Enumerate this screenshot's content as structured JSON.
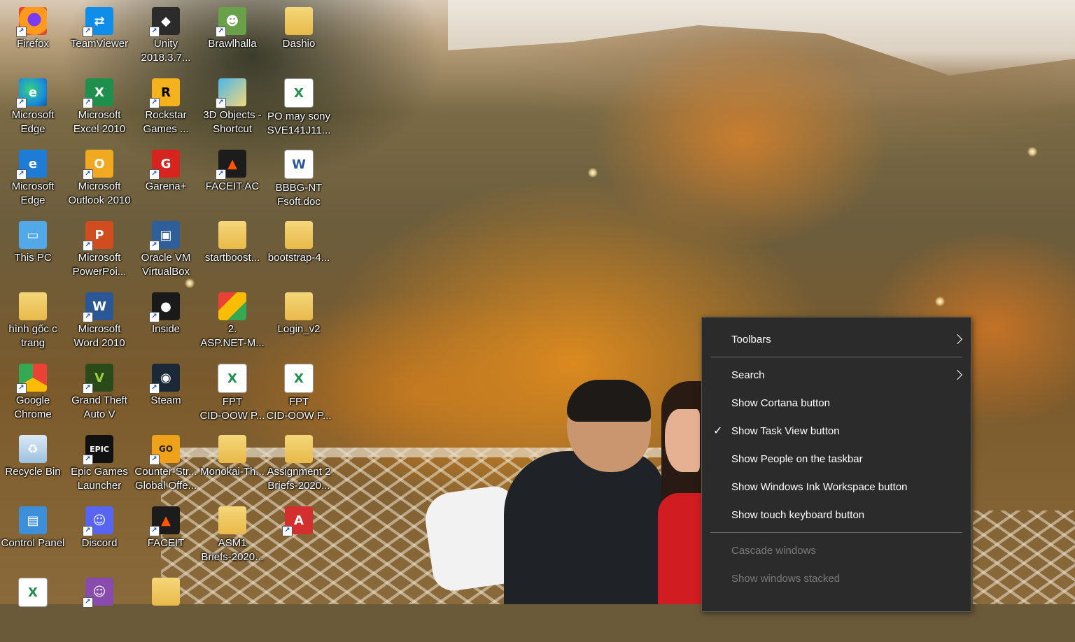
{
  "desktop": {
    "icons": [
      {
        "label": "Firefox",
        "icon": "firefox-icon",
        "glyph": ""
      },
      {
        "label": "TeamViewer",
        "icon": "teamviewer-icon",
        "glyph": "⇄"
      },
      {
        "label": "Unity\n2018.3.7...",
        "icon": "unity-icon",
        "glyph": "◆"
      },
      {
        "label": "Brawlhalla",
        "icon": "brawlhalla-icon",
        "glyph": "☻"
      },
      {
        "label": "Dashio",
        "icon": "folder-icon",
        "glyph": ""
      },
      {
        "label": "Microsoft\nEdge",
        "icon": "edge-icon",
        "glyph": "e"
      },
      {
        "label": "Microsoft\nExcel 2010",
        "icon": "excel-icon",
        "glyph": "X"
      },
      {
        "label": "Rockstar\nGames ...",
        "icon": "rockstar-icon",
        "glyph": "R"
      },
      {
        "label": "3D Objects -\nShortcut",
        "icon": "3d-objects-icon",
        "glyph": ""
      },
      {
        "label": "PO may sony\nSVE141J11...",
        "icon": "excel-file-icon",
        "glyph": "X"
      },
      {
        "label": "Microsoft\nEdge",
        "icon": "edge-legacy-icon",
        "glyph": "e"
      },
      {
        "label": "Microsoft\nOutlook 2010",
        "icon": "outlook-icon",
        "glyph": "O"
      },
      {
        "label": "Garena+",
        "icon": "garena-icon",
        "glyph": "G"
      },
      {
        "label": "FACEIT AC",
        "icon": "faceit-ac-icon",
        "glyph": "▲"
      },
      {
        "label": "BBBG-NT\nFsoft.doc",
        "icon": "word-file-icon",
        "glyph": "W"
      },
      {
        "label": "This PC",
        "icon": "this-pc-icon",
        "glyph": "▭"
      },
      {
        "label": "Microsoft\nPowerPoi...",
        "icon": "powerpoint-icon",
        "glyph": "P"
      },
      {
        "label": "Oracle VM\nVirtualBox",
        "icon": "virtualbox-icon",
        "glyph": "▣"
      },
      {
        "label": "startboost...",
        "icon": "folder-icon",
        "glyph": ""
      },
      {
        "label": "bootstrap-4...",
        "icon": "folder-icon",
        "glyph": ""
      },
      {
        "label": "hình gốc  c\ntrang",
        "icon": "folder-icon",
        "glyph": ""
      },
      {
        "label": "Microsoft\nWord 2010",
        "icon": "word-icon",
        "glyph": "W"
      },
      {
        "label": "Inside",
        "icon": "inside-icon",
        "glyph": "●"
      },
      {
        "label": "2.\nASP.NET-M...",
        "icon": "chrome-doc-icon",
        "glyph": ""
      },
      {
        "label": "Login_v2",
        "icon": "folder-icon",
        "glyph": ""
      },
      {
        "label": "Google\nChrome",
        "icon": "chrome-icon",
        "glyph": ""
      },
      {
        "label": "Grand Theft\nAuto V",
        "icon": "gta-icon",
        "glyph": "V"
      },
      {
        "label": "Steam",
        "icon": "steam-icon",
        "glyph": "◉"
      },
      {
        "label": "FPT\nCID-OOW P...",
        "icon": "excel-file-icon",
        "glyph": "X"
      },
      {
        "label": "FPT\nCID-OOW P...",
        "icon": "excel-file-icon",
        "glyph": "X"
      },
      {
        "label": "Recycle Bin",
        "icon": "recycle-bin-icon",
        "glyph": "♻"
      },
      {
        "label": "Epic Games\nLauncher",
        "icon": "epic-games-icon",
        "glyph": "EPIC"
      },
      {
        "label": "Counter-Str...\nGlobal Offe...",
        "icon": "csgo-icon",
        "glyph": "GO"
      },
      {
        "label": "Monokai-Th...",
        "icon": "folder-icon",
        "glyph": ""
      },
      {
        "label": "Assignment 2\nBriefs-2020...",
        "icon": "folder-icon",
        "glyph": ""
      },
      {
        "label": "Control Panel",
        "icon": "control-panel-icon",
        "glyph": "▤"
      },
      {
        "label": "Discord",
        "icon": "discord-icon",
        "glyph": "☺"
      },
      {
        "label": "FACEIT",
        "icon": "faceit-icon",
        "glyph": "▲"
      },
      {
        "label": "ASM1\nBriefs-2020...",
        "icon": "folder-icon",
        "glyph": ""
      },
      {
        "label": "",
        "icon": "pdf-icon",
        "glyph": "A"
      },
      {
        "label": "",
        "icon": "excel-file-icon",
        "glyph": "X"
      },
      {
        "label": "",
        "icon": "github-icon",
        "glyph": "☺"
      },
      {
        "label": "",
        "icon": "folder-icon",
        "glyph": ""
      }
    ]
  },
  "context_menu": {
    "toolbars": "Toolbars",
    "search": "Search",
    "show_cortana": "Show Cortana button",
    "show_task_view": "Show Task View button",
    "show_task_view_checked": "✓",
    "show_people": "Show People on the taskbar",
    "show_ink": "Show Windows Ink Workspace button",
    "show_touch_keyboard": "Show touch keyboard button",
    "cascade": "Cascade windows",
    "stacked": "Show windows stacked"
  },
  "colors": {
    "menu_bg": "#2b2b2b",
    "menu_text": "#ffffff",
    "menu_disabled_text": "#7a7a7a"
  }
}
